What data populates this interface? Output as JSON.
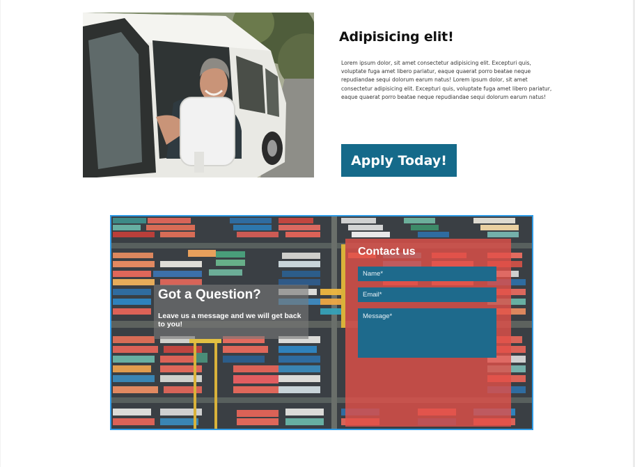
{
  "promo": {
    "title": "Adipisicing elit!",
    "body": "Lorem ipsum dolor, sit amet consectetur adipisicing elit. Excepturi quis, voluptate fuga amet libero pariatur, eaque quaerat porro beatae neque repudiandae sequi dolorum earum natus! Lorem ipsum dolor, sit amet consectetur adipisicing elit. Excepturi quis, voluptate fuga amet libero pariatur, eaque quaerat porro beatae neque repudiandae sequi dolorum earum natus!",
    "apply_label": "Apply Today!",
    "button_color": "#156a8a"
  },
  "contact": {
    "question_title": "Got a Question?",
    "question_subtitle": "Leave us a message and we will get back to you!",
    "form_title": "Contact us",
    "name_placeholder": "Name*",
    "email_placeholder": "Email*",
    "message_placeholder": "Message*",
    "form_color": "#e25048",
    "field_color": "#1e6a8c",
    "border_color": "#2f9be6"
  },
  "icons": {
    "hero_image": "man-driving-van-photo",
    "background_image": "shipping-containers-aerial-photo"
  }
}
